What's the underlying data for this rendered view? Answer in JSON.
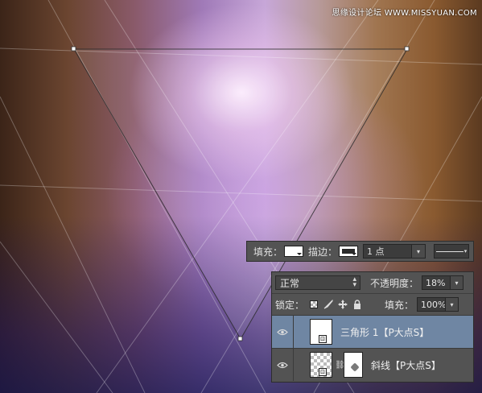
{
  "watermark": "思缘设计论坛 WWW.MISSYUAN.COM",
  "options_bar": {
    "fill_label": "填充：",
    "stroke_label": "描边：",
    "stroke_size": "1 点",
    "dropdown_glyph": "▾"
  },
  "layers_panel": {
    "blend_mode": "正常",
    "opacity_label": "不透明度：",
    "opacity_value": "18%",
    "lock_label": "锁定：",
    "fill_label": "填充：",
    "fill_value": "100%",
    "eye_glyph": "👁",
    "layers": [
      {
        "name": "三角形 1【P大点S】",
        "selected": true,
        "visible": true
      },
      {
        "name": "斜线【P大点S】",
        "selected": false,
        "visible": true
      }
    ]
  },
  "colors": {
    "panel_bg": "#535353",
    "selected_row": "#6f86a3",
    "field_bg": "#3c3c3c"
  },
  "icons": {
    "lock_transparent": "checker-icon",
    "lock_paint": "brush-icon",
    "lock_move": "move-icon",
    "lock_all": "lock-icon",
    "visibility": "eye-icon",
    "link": "chain-icon"
  }
}
